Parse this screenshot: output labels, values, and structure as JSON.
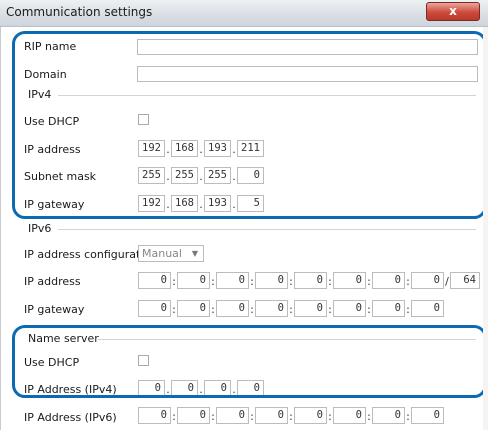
{
  "window": {
    "title": "Communication settings",
    "close_glyph": "x"
  },
  "rip_name": {
    "label": "RIP name",
    "value": ""
  },
  "domain": {
    "label": "Domain",
    "value": ""
  },
  "ipv4": {
    "group": "IPv4",
    "use_dhcp": {
      "label": "Use DHCP",
      "checked": false
    },
    "ip_address": {
      "label": "IP address",
      "octets": [
        "192",
        "168",
        "193",
        "211"
      ]
    },
    "subnet_mask": {
      "label": "Subnet mask",
      "octets": [
        "255",
        "255",
        "255",
        "0"
      ]
    },
    "ip_gateway": {
      "label": "IP gateway",
      "octets": [
        "192",
        "168",
        "193",
        "5"
      ]
    }
  },
  "ipv6": {
    "group": "IPv6",
    "config": {
      "label": "IP address configuration",
      "value": "Manual"
    },
    "ip_address": {
      "label": "IP address",
      "hextets": [
        "0",
        "0",
        "0",
        "0",
        "0",
        "0",
        "0",
        "0"
      ],
      "prefix": "64"
    },
    "ip_gateway": {
      "label": "IP gateway",
      "hextets": [
        "0",
        "0",
        "0",
        "0",
        "0",
        "0",
        "0",
        "0"
      ]
    }
  },
  "name_server": {
    "group": "Name server",
    "use_dhcp": {
      "label": "Use DHCP",
      "checked": false
    },
    "ipv4": {
      "label": "IP Address (IPv4)",
      "octets": [
        "0",
        "0",
        "0",
        "0"
      ]
    },
    "ipv6": {
      "label": "IP Address (IPv6)",
      "hextets": [
        "0",
        "0",
        "0",
        "0",
        "0",
        "0",
        "0",
        "0"
      ]
    }
  },
  "separators": {
    "ipv4": ".",
    "ipv6": ":",
    "prefix": "/"
  },
  "colors": {
    "highlight": "#0c6ab1",
    "close": "#c9453a"
  }
}
